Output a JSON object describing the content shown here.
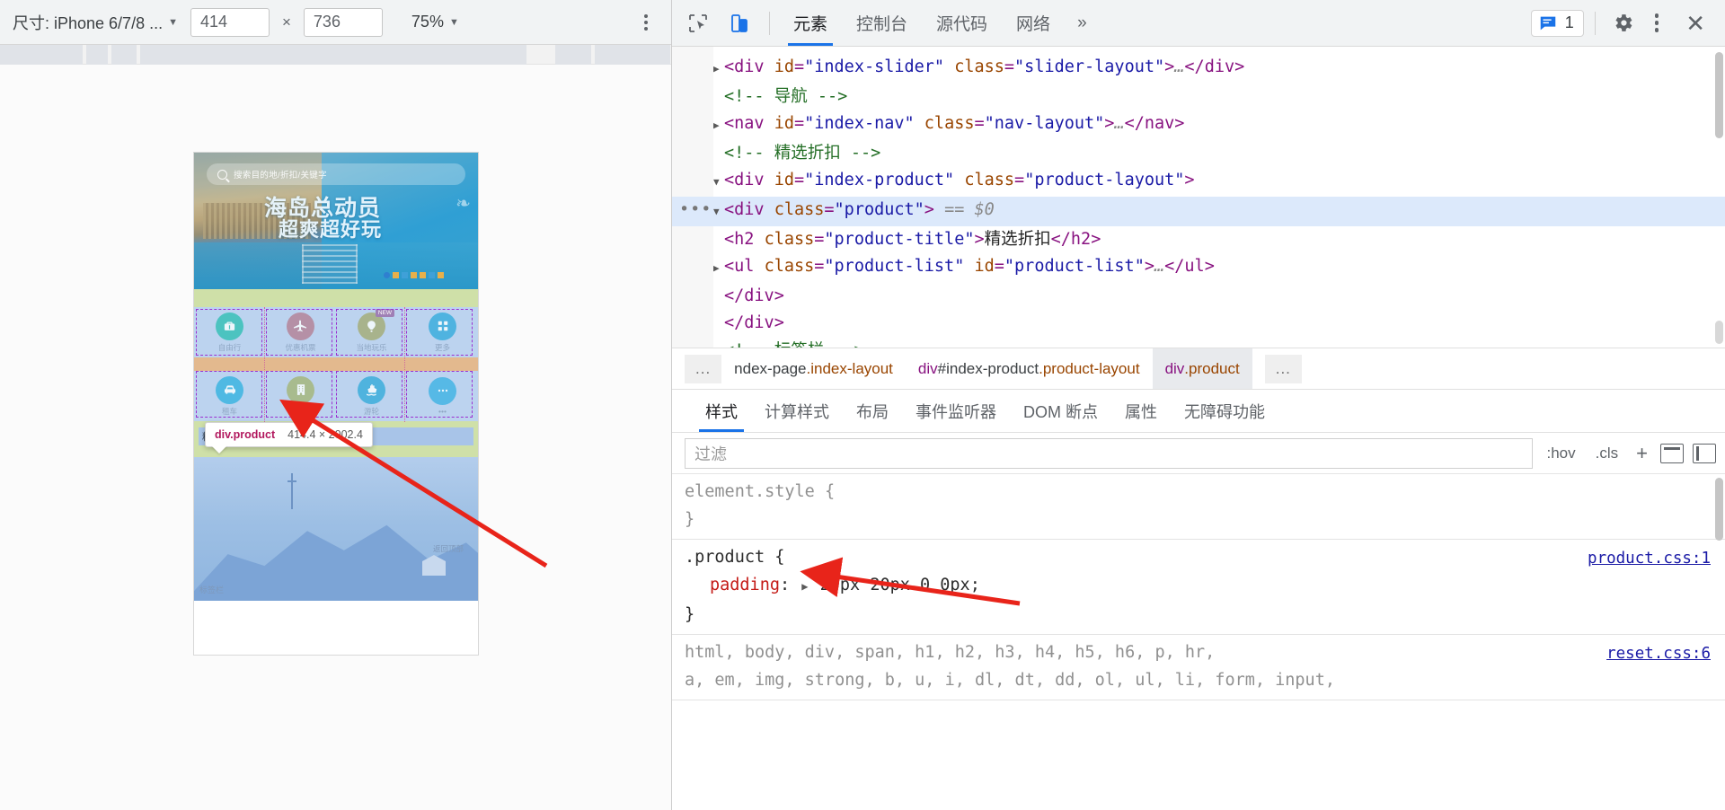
{
  "device_toolbar": {
    "size_label": "尺寸: iPhone 6/7/8 ...",
    "width": "414",
    "height": "736",
    "dim_separator": "×",
    "zoom": "75%",
    "caret": "▼",
    "more_icon": "kebab-menu-icon"
  },
  "mobile_page": {
    "search_placeholder": "搜索目的地/折扣/关键字",
    "hero_title_line1": "海岛总动员",
    "hero_title_line2": "超爽超好玩",
    "nav_row1": [
      {
        "label": "自由行",
        "icon": "suitcase-icon",
        "color": "#4cc3c0",
        "badge": ""
      },
      {
        "label": "优惠机票",
        "icon": "airplane-icon",
        "color": "#b590a6",
        "badge": ""
      },
      {
        "label": "当地玩乐",
        "icon": "hot-air-balloon-icon",
        "color": "#a8b38c",
        "badge": "NEW"
      },
      {
        "label": "更多",
        "icon": "grid-more-icon",
        "color": "#4fb3e0",
        "badge": ""
      }
    ],
    "nav_row2": [
      {
        "label": "租车",
        "icon": "car-icon",
        "color": "#4fb9e3",
        "badge": ""
      },
      {
        "label": "酒店",
        "icon": "hotel-building-icon",
        "color": "#a8bb8e",
        "badge": ""
      },
      {
        "label": "游轮",
        "icon": "cruise-ship-icon",
        "color": "#4fb3de",
        "badge": ""
      },
      {
        "label": "•••",
        "icon": "ellipsis-icon",
        "color": "#56b9e6",
        "badge": ""
      }
    ],
    "product_title": "精选折扣",
    "back_to_top": "返回顶部",
    "tab_bar_label": "标签栏"
  },
  "highlight_tooltip": {
    "element": "div.product",
    "dimensions": "414.4 × 2002.4"
  },
  "devtools": {
    "toolbar_icons": [
      "inspect-element-icon",
      "device-toggle-icon"
    ],
    "panel_tabs": [
      {
        "label": "元素",
        "selected": true
      },
      {
        "label": "控制台",
        "selected": false
      },
      {
        "label": "源代码",
        "selected": false
      },
      {
        "label": "网络",
        "selected": false
      }
    ],
    "more_tabs_icon": "chevron-double-right-icon",
    "message_count": "1",
    "message_icon": "console-message-icon",
    "settings_icon": "gear-icon",
    "kebab_icon": "kebab-menu-icon",
    "close_icon": "close-icon",
    "dom_lines": [
      {
        "indent": 5,
        "triangle": "▶",
        "parts": [
          {
            "t": "punc",
            "v": "<"
          },
          {
            "t": "tagp",
            "v": "div"
          },
          {
            "t": "sp",
            "v": " "
          },
          {
            "t": "attr",
            "v": "id"
          },
          {
            "t": "punc",
            "v": "="
          },
          {
            "t": "val",
            "v": "\"index-slider\""
          },
          {
            "t": "sp",
            "v": " "
          },
          {
            "t": "attr",
            "v": "class"
          },
          {
            "t": "punc",
            "v": "="
          },
          {
            "t": "val",
            "v": "\"slider-layout\""
          },
          {
            "t": "punc",
            "v": ">"
          },
          {
            "t": "gray",
            "v": "…"
          },
          {
            "t": "punc",
            "v": "</"
          },
          {
            "t": "tagp",
            "v": "div"
          },
          {
            "t": "punc",
            "v": ">"
          }
        ]
      },
      {
        "indent": 6,
        "triangle": "",
        "comment": "<!-- 导航 -->"
      },
      {
        "indent": 5,
        "triangle": "▶",
        "parts": [
          {
            "t": "punc",
            "v": "<"
          },
          {
            "t": "tagp",
            "v": "nav"
          },
          {
            "t": "sp",
            "v": " "
          },
          {
            "t": "attr",
            "v": "id"
          },
          {
            "t": "punc",
            "v": "="
          },
          {
            "t": "val",
            "v": "\"index-nav\""
          },
          {
            "t": "sp",
            "v": " "
          },
          {
            "t": "attr",
            "v": "class"
          },
          {
            "t": "punc",
            "v": "="
          },
          {
            "t": "val",
            "v": "\"nav-layout\""
          },
          {
            "t": "punc",
            "v": ">"
          },
          {
            "t": "gray",
            "v": "…"
          },
          {
            "t": "punc",
            "v": "</"
          },
          {
            "t": "tagp",
            "v": "nav"
          },
          {
            "t": "punc",
            "v": ">"
          }
        ]
      },
      {
        "indent": 6,
        "triangle": "",
        "comment": "<!-- 精选折扣 -->"
      },
      {
        "indent": 5,
        "triangle": "▼",
        "parts": [
          {
            "t": "punc",
            "v": "<"
          },
          {
            "t": "tagp",
            "v": "div"
          },
          {
            "t": "sp",
            "v": " "
          },
          {
            "t": "attr",
            "v": "id"
          },
          {
            "t": "punc",
            "v": "="
          },
          {
            "t": "val",
            "v": "\"index-product\""
          },
          {
            "t": "sp",
            "v": " "
          },
          {
            "t": "attr",
            "v": "class"
          },
          {
            "t": "punc",
            "v": "="
          },
          {
            "t": "val",
            "v": "\"product-layout\""
          },
          {
            "t": "punc",
            "v": ">"
          }
        ]
      },
      {
        "indent": 7,
        "triangle": "▼",
        "selected": true,
        "ellipsis": "•••",
        "parts": [
          {
            "t": "punc",
            "v": "<"
          },
          {
            "t": "tagp",
            "v": "div"
          },
          {
            "t": "sp",
            "v": " "
          },
          {
            "t": "attr",
            "v": "class"
          },
          {
            "t": "punc",
            "v": "="
          },
          {
            "t": "val",
            "v": "\"product\""
          },
          {
            "t": "punc",
            "v": ">"
          },
          {
            "t": "sp",
            "v": " "
          },
          {
            "t": "gray",
            "v": "== $0"
          }
        ]
      },
      {
        "indent": 9,
        "triangle": "",
        "parts": [
          {
            "t": "punc",
            "v": "<"
          },
          {
            "t": "tagp",
            "v": "h2"
          },
          {
            "t": "sp",
            "v": " "
          },
          {
            "t": "attr",
            "v": "class"
          },
          {
            "t": "punc",
            "v": "="
          },
          {
            "t": "val",
            "v": "\"product-title\""
          },
          {
            "t": "punc",
            "v": ">"
          },
          {
            "t": "txt",
            "v": "精选折扣"
          },
          {
            "t": "punc",
            "v": "</"
          },
          {
            "t": "tagp",
            "v": "h2"
          },
          {
            "t": "punc",
            "v": ">"
          }
        ]
      },
      {
        "indent": 8,
        "triangle": "▶",
        "parts": [
          {
            "t": "punc",
            "v": "<"
          },
          {
            "t": "tagp",
            "v": "ul"
          },
          {
            "t": "sp",
            "v": " "
          },
          {
            "t": "attr",
            "v": "class"
          },
          {
            "t": "punc",
            "v": "="
          },
          {
            "t": "val",
            "v": "\"product-list\""
          },
          {
            "t": "sp",
            "v": " "
          },
          {
            "t": "attr",
            "v": "id"
          },
          {
            "t": "punc",
            "v": "="
          },
          {
            "t": "val",
            "v": "\"product-list\""
          },
          {
            "t": "punc",
            "v": ">"
          },
          {
            "t": "gray",
            "v": "…"
          },
          {
            "t": "punc",
            "v": "</"
          },
          {
            "t": "tagp",
            "v": "ul"
          },
          {
            "t": "punc",
            "v": ">"
          }
        ]
      },
      {
        "indent": 8,
        "triangle": "",
        "parts": [
          {
            "t": "punc",
            "v": "</"
          },
          {
            "t": "tagp",
            "v": "div"
          },
          {
            "t": "punc",
            "v": ">"
          }
        ]
      },
      {
        "indent": 6,
        "triangle": "",
        "parts": [
          {
            "t": "punc",
            "v": "</"
          },
          {
            "t": "tagp",
            "v": "div"
          },
          {
            "t": "punc",
            "v": ">"
          }
        ]
      },
      {
        "indent": 6,
        "triangle": "",
        "comment": "<!-- 标签栏 -->"
      }
    ],
    "breadcrumb": {
      "overflow": "...",
      "items": [
        {
          "element": "",
          "id_text": "ndex-page",
          "cls": ".index-layout",
          "selected": false
        },
        {
          "element": "div",
          "id_text": "#index-product",
          "cls": ".product-layout",
          "selected": false
        },
        {
          "element": "div",
          "id_text": "",
          "cls": ".product",
          "selected": true
        }
      ],
      "trailing": "..."
    },
    "style_tabs": [
      {
        "label": "样式",
        "selected": true
      },
      {
        "label": "计算样式",
        "selected": false
      },
      {
        "label": "布局",
        "selected": false
      },
      {
        "label": "事件监听器",
        "selected": false
      },
      {
        "label": "DOM 断点",
        "selected": false
      },
      {
        "label": "属性",
        "selected": false
      },
      {
        "label": "无障碍功能",
        "selected": false
      }
    ],
    "filter": {
      "placeholder": "过滤",
      "hov": ":hov",
      "cls": ".cls",
      "plus": "+",
      "new_style_rule_icon": "new-style-rule-icon",
      "toggle_sidebar_icon": "toggle-sidebar-icon"
    },
    "css_rules": [
      {
        "selector": "element.style",
        "open": "{",
        "close": "}",
        "source": "",
        "declarations": []
      },
      {
        "selector": ".product",
        "open": "{",
        "close": "}",
        "source": "product.css:1",
        "declarations": [
          {
            "property": "padding",
            "expand": "▶",
            "value": "20px 20px 0 0px;"
          }
        ]
      },
      {
        "selector": "html, body, div, span, h1, h2, h3, h4, h5, h6, p, hr,\na, em, img, strong, b, u, i, dl, dt, dd, ol, ul, li, form, input,",
        "open": "",
        "close": "",
        "source": "reset.css:6",
        "declarations": []
      }
    ]
  },
  "colors": {
    "accent": "#1a73e8",
    "highlight_row": "#dce9fb",
    "annotation_arrow": "#e8241a",
    "padding_overlay": "#9b30d0",
    "content_overlay": "#cfe0a8"
  }
}
